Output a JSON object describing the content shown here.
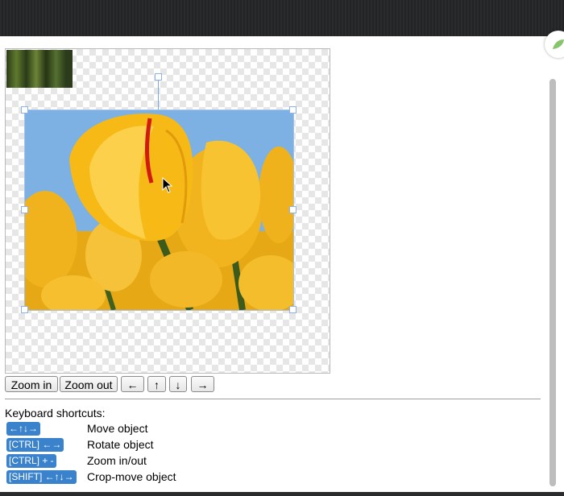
{
  "toolbar": {
    "zoom_in": "Zoom in",
    "zoom_out": "Zoom out",
    "left": "←",
    "up": "↑",
    "down": "↓",
    "right": "→"
  },
  "shortcuts": {
    "title": "Keyboard shortcuts:",
    "items": [
      {
        "key": "←↑↓→",
        "desc": "Move object"
      },
      {
        "key": "[CTRL] ←→",
        "desc": "Rotate object"
      },
      {
        "key": "[CTRL] + -",
        "desc": "Zoom in/out"
      },
      {
        "key": "[SHIFT] ←↑↓→",
        "desc": "Crop-move object"
      }
    ]
  },
  "colors": {
    "key_bg": "#3a83cc",
    "selection": "#8fb3e6",
    "sky": "#7db1e4",
    "tulip": "#f3b51a"
  },
  "icons": {
    "cursor": "arrow-cursor-icon",
    "corner": "leaf-icon"
  }
}
